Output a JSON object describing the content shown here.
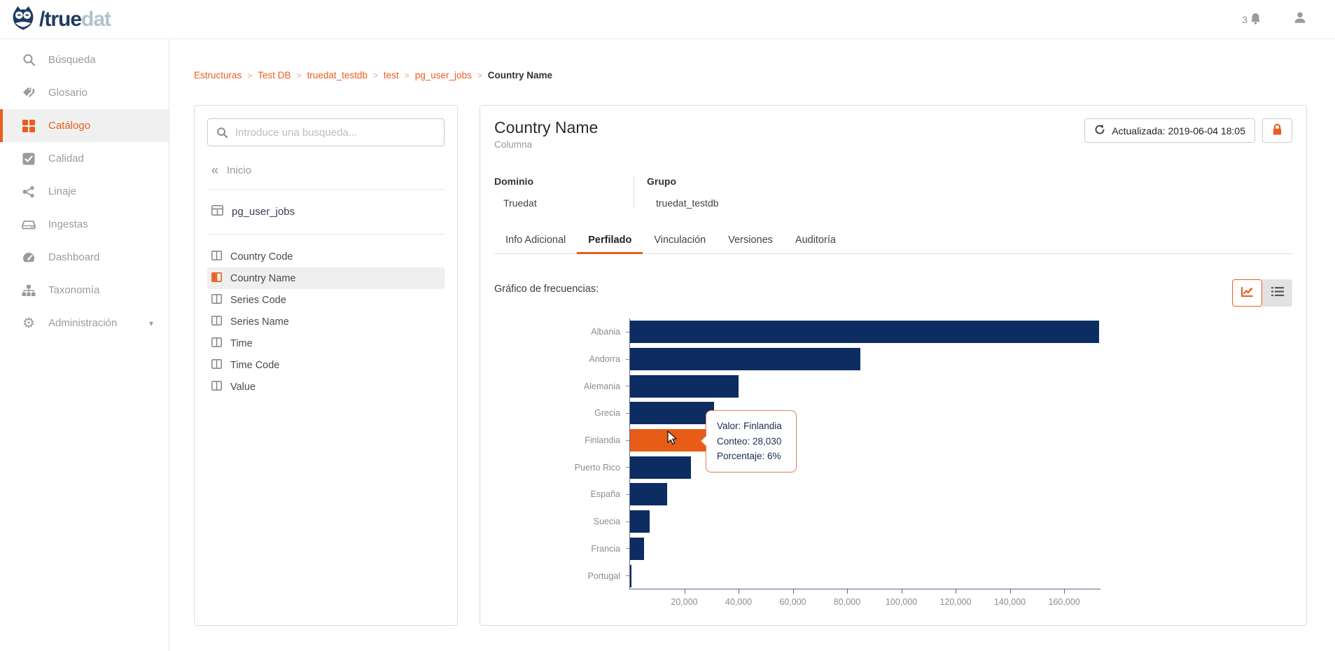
{
  "brand": {
    "name_dark": "/true",
    "name_light": "dat"
  },
  "topbar": {
    "notification_count": "3"
  },
  "sidebar": {
    "items": [
      {
        "label": "Búsqueda",
        "active": false
      },
      {
        "label": "Glosario",
        "active": false
      },
      {
        "label": "Catálogo",
        "active": true
      },
      {
        "label": "Calidad",
        "active": false
      },
      {
        "label": "Linaje",
        "active": false
      },
      {
        "label": "Ingestas",
        "active": false
      },
      {
        "label": "Dashboard",
        "active": false
      },
      {
        "label": "Taxonomía",
        "active": false
      },
      {
        "label": "Administración",
        "active": false,
        "expandable": true
      }
    ]
  },
  "breadcrumb": {
    "links": [
      "Estructuras",
      "Test DB",
      "truedat_testdb",
      "test",
      "pg_user_jobs"
    ],
    "separator": ">",
    "current": "Country Name"
  },
  "tree_panel": {
    "search_placeholder": "Introduce una busqueda...",
    "search_value": "",
    "back_label": "Inicio",
    "table_name": "pg_user_jobs",
    "columns": [
      "Country Code",
      "Country Name",
      "Series Code",
      "Series Name",
      "Time",
      "Time Code",
      "Value"
    ],
    "selected_column": "Country Name"
  },
  "detail": {
    "title": "Country Name",
    "subtitle": "Columna",
    "updated_button": "Actualizada: 2019-06-04 18:05",
    "fields": {
      "domain_label": "Dominio",
      "domain_value": "Truedat",
      "group_label": "Grupo",
      "group_value": "truedat_testdb"
    },
    "tabs": [
      {
        "label": "Info Adicional",
        "active": false
      },
      {
        "label": "Perfilado",
        "active": true
      },
      {
        "label": "Vinculación",
        "active": false
      },
      {
        "label": "Versiones",
        "active": false
      },
      {
        "label": "Auditoría",
        "active": false
      }
    ]
  },
  "colors": {
    "accent_orange": "#EB5D1F",
    "bar_navy": "#0C2C62",
    "bar_highlight": "#E85C17",
    "tooltip_border": "#E8835A",
    "logo_navy": "#1C3C5E",
    "logo_light": "#AFC4CE"
  },
  "chart_data": {
    "type": "bar",
    "orientation": "horizontal",
    "title": "Gráfico de frecuencias:",
    "categories": [
      "Albania",
      "Andorra",
      "Alemania",
      "Grecia",
      "Finlandia",
      "Puerto Rico",
      "España",
      "Suecia",
      "Francia",
      "Portugal"
    ],
    "values": [
      173000,
      85000,
      40000,
      31000,
      28030,
      22500,
      13700,
      7100,
      5200,
      500
    ],
    "highlighted_category": "Finlandia",
    "highlighted_value": 28030,
    "highlighted_percentage": "6%",
    "xlim": [
      0,
      173400
    ],
    "x_ticks": [
      20000,
      40000,
      60000,
      80000,
      100000,
      120000,
      140000,
      160000
    ],
    "x_tick_labels": [
      "20,000",
      "40,000",
      "60,000",
      "80,000",
      "100,000",
      "120,000",
      "140,000",
      "160,000"
    ],
    "grid": false,
    "legend_position": "none",
    "tooltip": {
      "line1": "Valor: Finlandia",
      "line2": "Conteo: 28,030",
      "line3": "Porcentaje: 6%"
    }
  }
}
